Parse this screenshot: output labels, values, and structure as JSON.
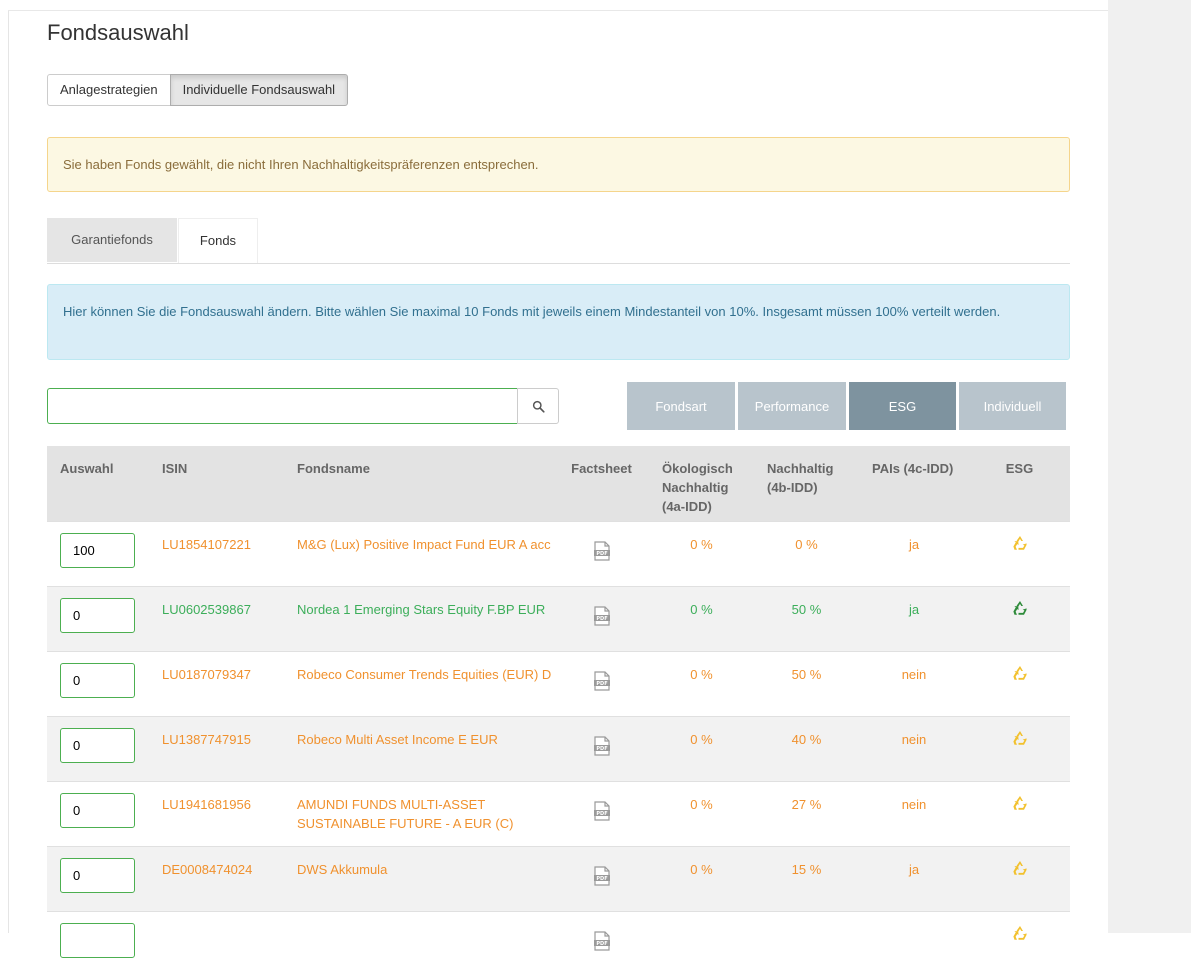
{
  "page": {
    "title": "Fondsauswahl"
  },
  "strategy_toggle": [
    {
      "label": "Anlagestrategien",
      "active": false
    },
    {
      "label": "Individuelle Fondsauswahl",
      "active": true
    }
  ],
  "warning": {
    "text": "Sie haben Fonds gewählt, die nicht Ihren Nachhaltigkeitspräferenzen entsprechen."
  },
  "tabs": [
    {
      "label": "Garantiefonds",
      "active": false
    },
    {
      "label": "Fonds",
      "active": true
    }
  ],
  "info": {
    "text": "Hier können Sie die Fondsauswahl ändern. Bitte wählen Sie maximal 10 Fonds mit jeweils einem Mindestanteil von 10%. Insgesamt müssen 100% verteilt werden."
  },
  "search": {
    "value": "",
    "icon": "search-icon"
  },
  "filters": [
    {
      "label": "Fondsart",
      "active": false
    },
    {
      "label": "Performance",
      "active": false
    },
    {
      "label": "ESG",
      "active": true
    },
    {
      "label": "Individuell",
      "active": false
    }
  ],
  "colors": {
    "orange": "#f0912e",
    "green": "#3cae5a",
    "esg_yellow": "#f2c12e",
    "esg_green": "#2e8b3a",
    "filter_active": "#7e939f",
    "filter_inactive": "#b8c4cc"
  },
  "table": {
    "headers": {
      "auswahl": "Auswahl",
      "isin": "ISIN",
      "fondsname": "Fondsname",
      "factsheet": "Factsheet",
      "oeko": "Ökologisch Nachhaltig (4a-IDD)",
      "nachhaltig": "Nachhaltig (4b-IDD)",
      "pais": "PAIs (4c-IDD)",
      "esg": "ESG"
    },
    "rows": [
      {
        "qty": "100",
        "isin": "LU1854107221",
        "name": "M&G (Lux) Positive Impact Fund EUR A acc",
        "oeko": "0 %",
        "nachhaltig": "0 %",
        "pais": "ja",
        "tone": "orange",
        "esg_icon": "recycle-icon"
      },
      {
        "qty": "0",
        "isin": "LU0602539867",
        "name": "Nordea 1 Emerging Stars Equity F.BP EUR",
        "oeko": "0 %",
        "nachhaltig": "50 %",
        "pais": "ja",
        "tone": "green",
        "esg_icon": "recycle-icon"
      },
      {
        "qty": "0",
        "isin": "LU0187079347",
        "name": "Robeco Consumer Trends Equities (EUR) D",
        "oeko": "0 %",
        "nachhaltig": "50 %",
        "pais": "nein",
        "tone": "orange",
        "esg_icon": "recycle-icon"
      },
      {
        "qty": "0",
        "isin": "LU1387747915",
        "name": "Robeco Multi Asset Income E EUR",
        "oeko": "0 %",
        "nachhaltig": "40 %",
        "pais": "nein",
        "tone": "orange",
        "esg_icon": "recycle-icon"
      },
      {
        "qty": "0",
        "isin": "LU1941681956",
        "name": "AMUNDI FUNDS MULTI-ASSET SUSTAINABLE FUTURE - A EUR (C)",
        "oeko": "0 %",
        "nachhaltig": "27 %",
        "pais": "nein",
        "tone": "orange",
        "esg_icon": "recycle-icon"
      },
      {
        "qty": "0",
        "isin": "DE0008474024",
        "name": "DWS Akkumula",
        "oeko": "0 %",
        "nachhaltig": "15 %",
        "pais": "ja",
        "tone": "orange",
        "esg_icon": "recycle-icon"
      },
      {
        "qty": "",
        "isin": "",
        "name": "",
        "oeko": "",
        "nachhaltig": "",
        "pais": "",
        "tone": "orange",
        "esg_icon": "recycle-icon"
      }
    ]
  }
}
